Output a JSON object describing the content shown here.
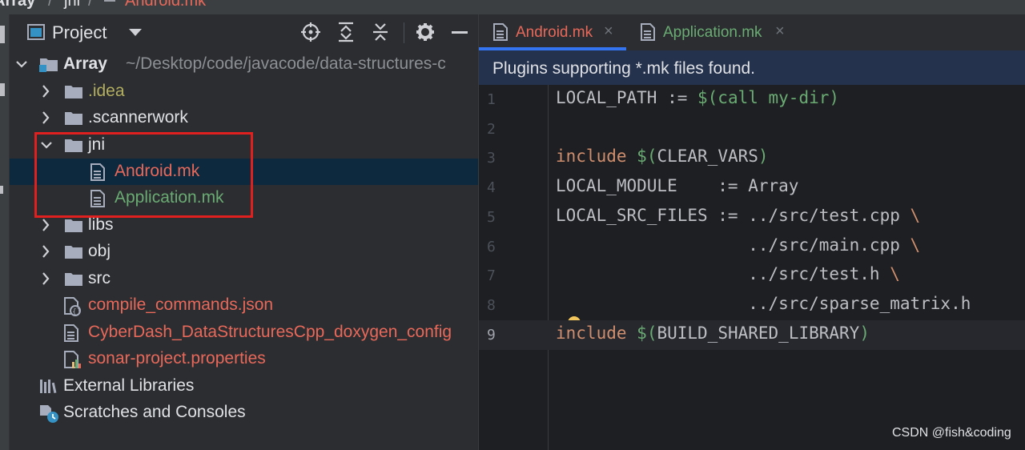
{
  "breadcrumb": {
    "root": "Array",
    "sep1": "/",
    "dir": "jni",
    "sep2": "/",
    "file": "Android.mk"
  },
  "project_panel": {
    "title": "Project",
    "tree": [
      {
        "id": "array",
        "label": "Array",
        "path": "~/Desktop/code/javacode/data-structures-c",
        "color": "#dfe1e5"
      },
      {
        "id": "idea",
        "label": ".idea",
        "color": "#b3ae60"
      },
      {
        "id": "scannerwork",
        "label": ".scannerwork",
        "color": "#dfe1e5"
      },
      {
        "id": "jni",
        "label": "jni",
        "color": "#dfe1e5"
      },
      {
        "id": "android-mk",
        "label": "Android.mk",
        "color": "#e8685a"
      },
      {
        "id": "application-mk",
        "label": "Application.mk",
        "color": "#6aab73"
      },
      {
        "id": "libs",
        "label": "libs",
        "color": "#dfe1e5"
      },
      {
        "id": "obj",
        "label": "obj",
        "color": "#dfe1e5"
      },
      {
        "id": "src",
        "label": "src",
        "color": "#dfe1e5"
      },
      {
        "id": "compile-commands",
        "label": "compile_commands.json",
        "color": "#e8685a"
      },
      {
        "id": "doxygen-config",
        "label": "CyberDash_DataStructuresCpp_doxygen_config",
        "color": "#e8685a"
      },
      {
        "id": "sonar-properties",
        "label": "sonar-project.properties",
        "color": "#e8685a"
      },
      {
        "id": "external-libraries",
        "label": "External Libraries",
        "color": "#dfe1e5"
      },
      {
        "id": "scratches",
        "label": "Scratches and Consoles",
        "color": "#dfe1e5"
      }
    ]
  },
  "editor": {
    "tabs": [
      {
        "label": "Android.mk",
        "color": "#e8685a",
        "close": "×",
        "active": true
      },
      {
        "label": "Application.mk",
        "color": "#6aab73",
        "close": "×",
        "active": false
      }
    ],
    "banner": "Plugins supporting *.mk files found.",
    "lines": [
      {
        "no": "1",
        "parts": [
          [
            "",
            "LOCAL_PATH := "
          ],
          [
            "fn",
            "$(call my-dir)"
          ]
        ]
      },
      {
        "no": "2",
        "parts": []
      },
      {
        "no": "3",
        "parts": [
          [
            "kw",
            "include"
          ],
          [
            "",
            " "
          ],
          [
            "fn",
            "$("
          ],
          [
            "",
            "CLEAR_VARS"
          ],
          [
            "fn",
            ")"
          ]
        ]
      },
      {
        "no": "4",
        "parts": [
          [
            "",
            "LOCAL_MODULE    := Array"
          ]
        ]
      },
      {
        "no": "5",
        "parts": [
          [
            "",
            "LOCAL_SRC_FILES := ../src/test.cpp "
          ],
          [
            "bs",
            "\\"
          ]
        ]
      },
      {
        "no": "6",
        "parts": [
          [
            "",
            "                   ../src/main.cpp "
          ],
          [
            "bs",
            "\\"
          ]
        ]
      },
      {
        "no": "7",
        "parts": [
          [
            "",
            "                   ../src/test.h "
          ],
          [
            "bs",
            "\\"
          ]
        ]
      },
      {
        "no": "8",
        "parts": [
          [
            "",
            "                   ../src/sparse_matrix.h"
          ]
        ]
      },
      {
        "no": "9",
        "parts": [
          [
            "kw",
            "include"
          ],
          [
            "",
            " "
          ],
          [
            "fn",
            "$("
          ],
          [
            "",
            "BUILD_SHARED_LIBRARY"
          ],
          [
            "fn",
            ")"
          ]
        ],
        "current": true
      }
    ]
  },
  "watermark": "CSDN @fish&coding",
  "colors": {
    "accent": "#3574f0",
    "highlight_box": "#e0201e",
    "selection": "#0d293e"
  }
}
